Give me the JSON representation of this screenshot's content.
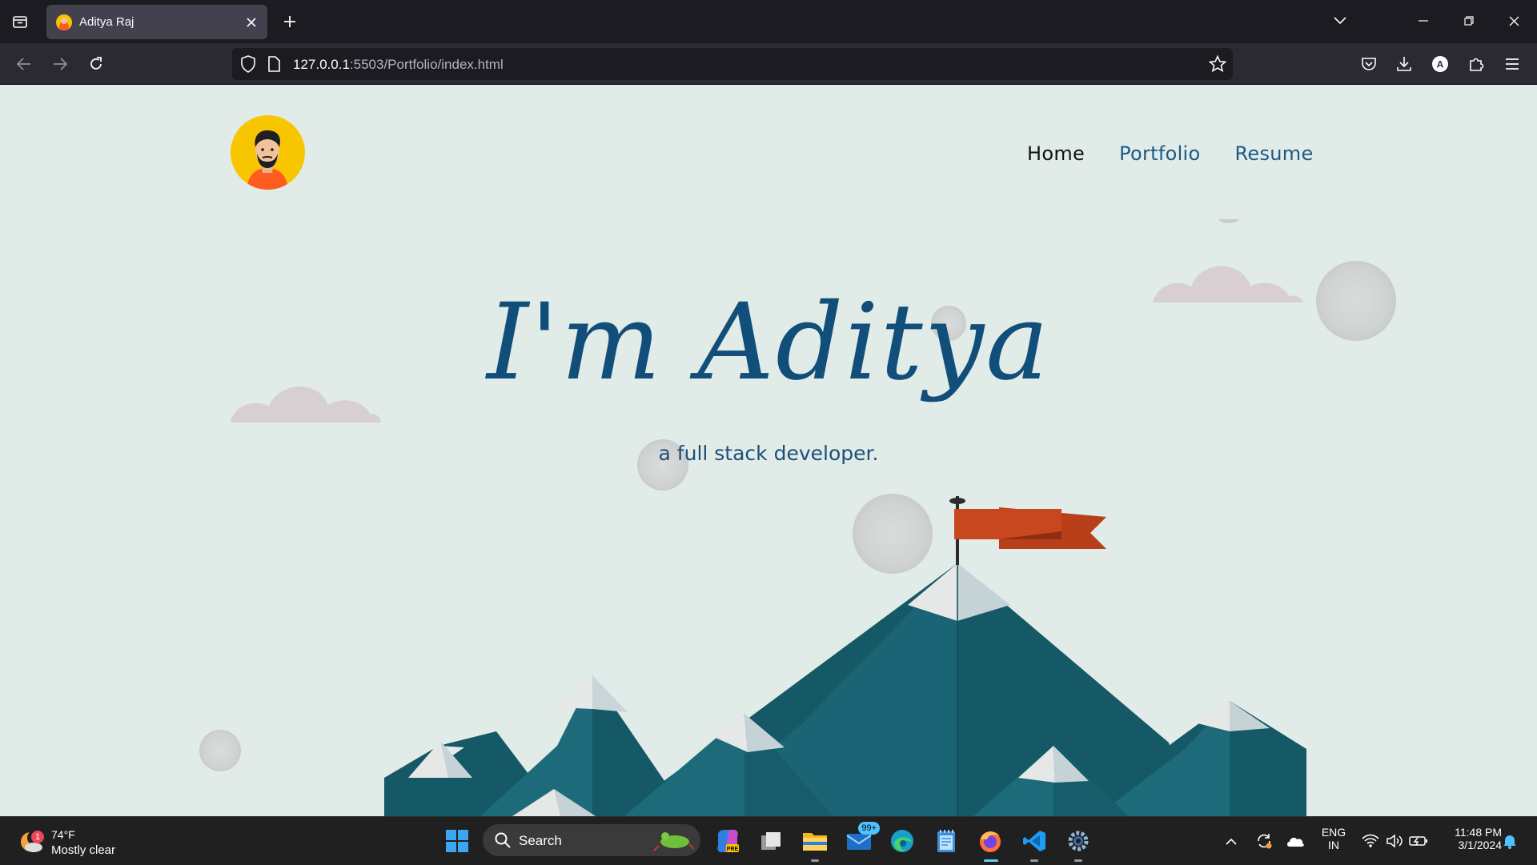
{
  "browser": {
    "tab": {
      "title": "Aditya Raj"
    },
    "url": {
      "host": "127.0.0.1",
      "rest": ":5503/Portfolio/index.html"
    }
  },
  "page": {
    "nav": [
      {
        "label": "Home",
        "active": true
      },
      {
        "label": "Portfolio",
        "active": false
      },
      {
        "label": "Resume",
        "active": false
      }
    ],
    "hero": {
      "title": "I'm Aditya",
      "subtitle": "a full stack developer."
    }
  },
  "taskbar": {
    "weather": {
      "temp": "74°F",
      "condition": "Mostly clear",
      "badge": "1"
    },
    "search_label": "Search",
    "mail_badge": "99+",
    "language": {
      "line1": "ENG",
      "line2": "IN"
    },
    "clock": {
      "time": "11:48 PM",
      "date": "3/1/2024"
    }
  },
  "colors": {
    "page_bg": "#e1ebe7",
    "accent": "#114e7a",
    "avatar_bg": "#f8c600",
    "flag": "#c9471f",
    "mountain_dark": "#155866",
    "mountain_light": "#1d6b7a"
  },
  "icons": {
    "tab_list": "tab-list-icon",
    "back": "back-arrow-icon",
    "forward": "forward-arrow-icon",
    "reload": "reload-icon",
    "bookmark": "star-icon",
    "pocket": "pocket-icon",
    "download": "download-icon",
    "account": "account-icon",
    "extensions": "puzzle-icon",
    "menu": "hamburger-menu-icon"
  }
}
